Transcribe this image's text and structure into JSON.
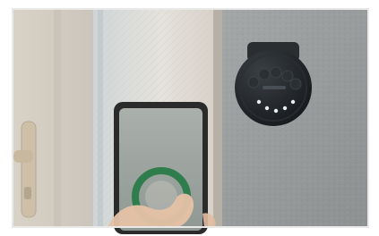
{
  "scene": {
    "description_tags": [
      "door",
      "door-handle",
      "smart-lock",
      "phone",
      "hand"
    ],
    "colors": {
      "frame_border": "#e9e9e9",
      "door_left": "#d9d4cc",
      "door_gap_glass": "#cfd6d9",
      "door_glass_mid": "#e7e4df",
      "door_edge": "#b9b2a8",
      "wall": "#9fa2a3",
      "lock_body": "#1f2326",
      "lock_top": "#2a2e31",
      "phone_frame": "#2b2b2b",
      "phone_screen": "#9ea7a1",
      "ring": "#2f7d4c",
      "hand": "#e6c2a7"
    },
    "lock": {
      "keypad_dots": 10,
      "lit_dots": 5
    }
  }
}
